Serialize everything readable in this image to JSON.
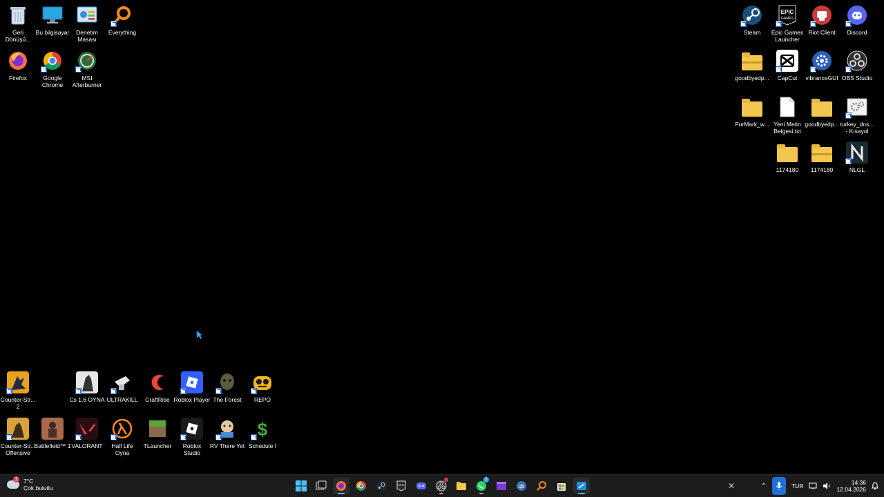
{
  "desktop": {
    "icons_left_top": [
      {
        "label": "Geri\nDönüşü...",
        "name": "recycle-bin"
      },
      {
        "label": "Bu bilgisayar",
        "name": "this-pc"
      },
      {
        "label": "Denetim\nMasası",
        "name": "control-panel"
      },
      {
        "label": "Everything",
        "name": "everything"
      },
      {
        "label": "Firefox",
        "name": "firefox"
      },
      {
        "label": "Google\nChrome",
        "name": "google-chrome"
      },
      {
        "label": "MSI\nAfterburner",
        "name": "msi-afterburner"
      }
    ],
    "icons_right": [
      {
        "label": "Steam",
        "name": "steam"
      },
      {
        "label": "Epic Games\nLauncher",
        "name": "epic-games-launcher"
      },
      {
        "label": "Riot Client",
        "name": "riot-client"
      },
      {
        "label": "Discord",
        "name": "discord"
      },
      {
        "label": "goodbyedp...",
        "name": "goodbyedpi-zip"
      },
      {
        "label": "CapCut",
        "name": "capcut"
      },
      {
        "label": "vibranceGUI",
        "name": "vibrancegui"
      },
      {
        "label": "OBS Studio",
        "name": "obs-studio"
      },
      {
        "label": "FurMark_w...",
        "name": "furmark-folder"
      },
      {
        "label": "Yeni Metin\nBelgesi.txt",
        "name": "text-document"
      },
      {
        "label": "goodbyedp...",
        "name": "goodbyedpi-folder"
      },
      {
        "label": "turkey_dns...\n- Kısayol",
        "name": "turkey-dns-shortcut"
      },
      {
        "label": "1174180",
        "name": "folder-1174180-a"
      },
      {
        "label": "1174180",
        "name": "folder-1174180-b"
      },
      {
        "label": "NLGL",
        "name": "nlgl"
      }
    ],
    "icons_bottom_row1": [
      {
        "label": "Counter-Str...\n2",
        "name": "counter-strike-2"
      },
      {
        "label": "Cs 1.6 OYNA",
        "name": "cs16"
      },
      {
        "label": "ULTRAKILL",
        "name": "ultrakill"
      },
      {
        "label": "CraftRise",
        "name": "craftrise"
      },
      {
        "label": "Roblox Player",
        "name": "roblox-player"
      },
      {
        "label": "The Forest",
        "name": "the-forest"
      },
      {
        "label": "REPO",
        "name": "repo"
      }
    ],
    "icons_bottom_row2": [
      {
        "label": "Counter-Str...\nOffensive",
        "name": "cs-go"
      },
      {
        "label": "Battlefield™ 1",
        "name": "battlefield-1"
      },
      {
        "label": "VALORANT",
        "name": "valorant"
      },
      {
        "label": "Half Life\nOyna",
        "name": "half-life"
      },
      {
        "label": "TLauncher",
        "name": "tlauncher"
      },
      {
        "label": "Roblox\nStudio",
        "name": "roblox-studio"
      },
      {
        "label": "RV There Yet",
        "name": "rv-there-yet"
      },
      {
        "label": "Schedule I",
        "name": "schedule-i"
      }
    ]
  },
  "taskbar": {
    "weather": {
      "temp": "7°C",
      "condition": "Çok bulutlu",
      "badge": "1"
    },
    "pinned": [
      "start",
      "task-view",
      "firefox",
      "chrome",
      "steam",
      "epic-games",
      "discord",
      "obs-studio",
      "file-explorer",
      "whatsapp",
      "capcut",
      "qbittorrent",
      "everything",
      "microsoft-store",
      "snipping-tool"
    ],
    "whatsapp_badge": "2",
    "language": "TUR",
    "time": "14:36",
    "date": "12.04.2026"
  },
  "colors": {
    "taskbar": "#1c1c1c",
    "accent": "#4cc2ff",
    "desktop_bg": "#000000"
  }
}
